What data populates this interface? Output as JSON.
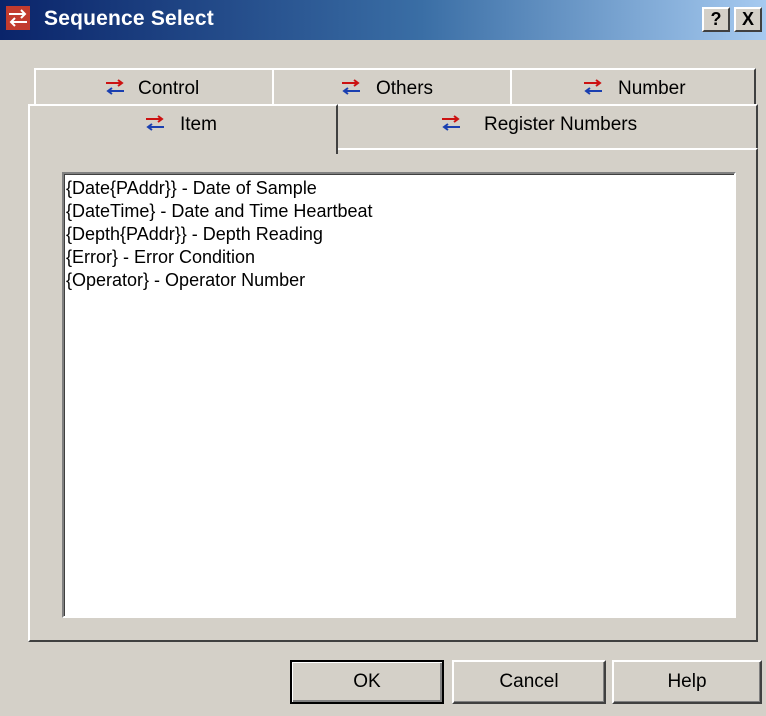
{
  "window": {
    "title": "Sequence Select",
    "help_button": "?",
    "close_button": "X",
    "icon": "sequence-arrows-icon"
  },
  "tabs": {
    "row_back": [
      {
        "label": "Control",
        "icon": "sequence-arrows-icon"
      },
      {
        "label": "Others",
        "icon": "sequence-arrows-icon"
      },
      {
        "label": "Number",
        "icon": "sequence-arrows-icon"
      }
    ],
    "row_front": [
      {
        "label": "Item",
        "icon": "sequence-arrows-icon",
        "selected": true
      },
      {
        "label": "Register Numbers",
        "icon": "sequence-arrows-icon"
      }
    ]
  },
  "list": {
    "items": [
      "{Date{PAddr}} - Date of Sample",
      "{DateTime} - Date and Time Heartbeat",
      "{Depth{PAddr}} - Depth Reading",
      "{Error} - Error Condition",
      "{Operator} - Operator Number"
    ]
  },
  "buttons": {
    "ok": "OK",
    "cancel": "Cancel",
    "help": "Help"
  },
  "colors": {
    "titlebar_start": "#0a246a",
    "titlebar_end": "#a6caf0",
    "face": "#d4d0c8",
    "icon_red": "#cc1111",
    "icon_blue": "#1a3fb0"
  }
}
